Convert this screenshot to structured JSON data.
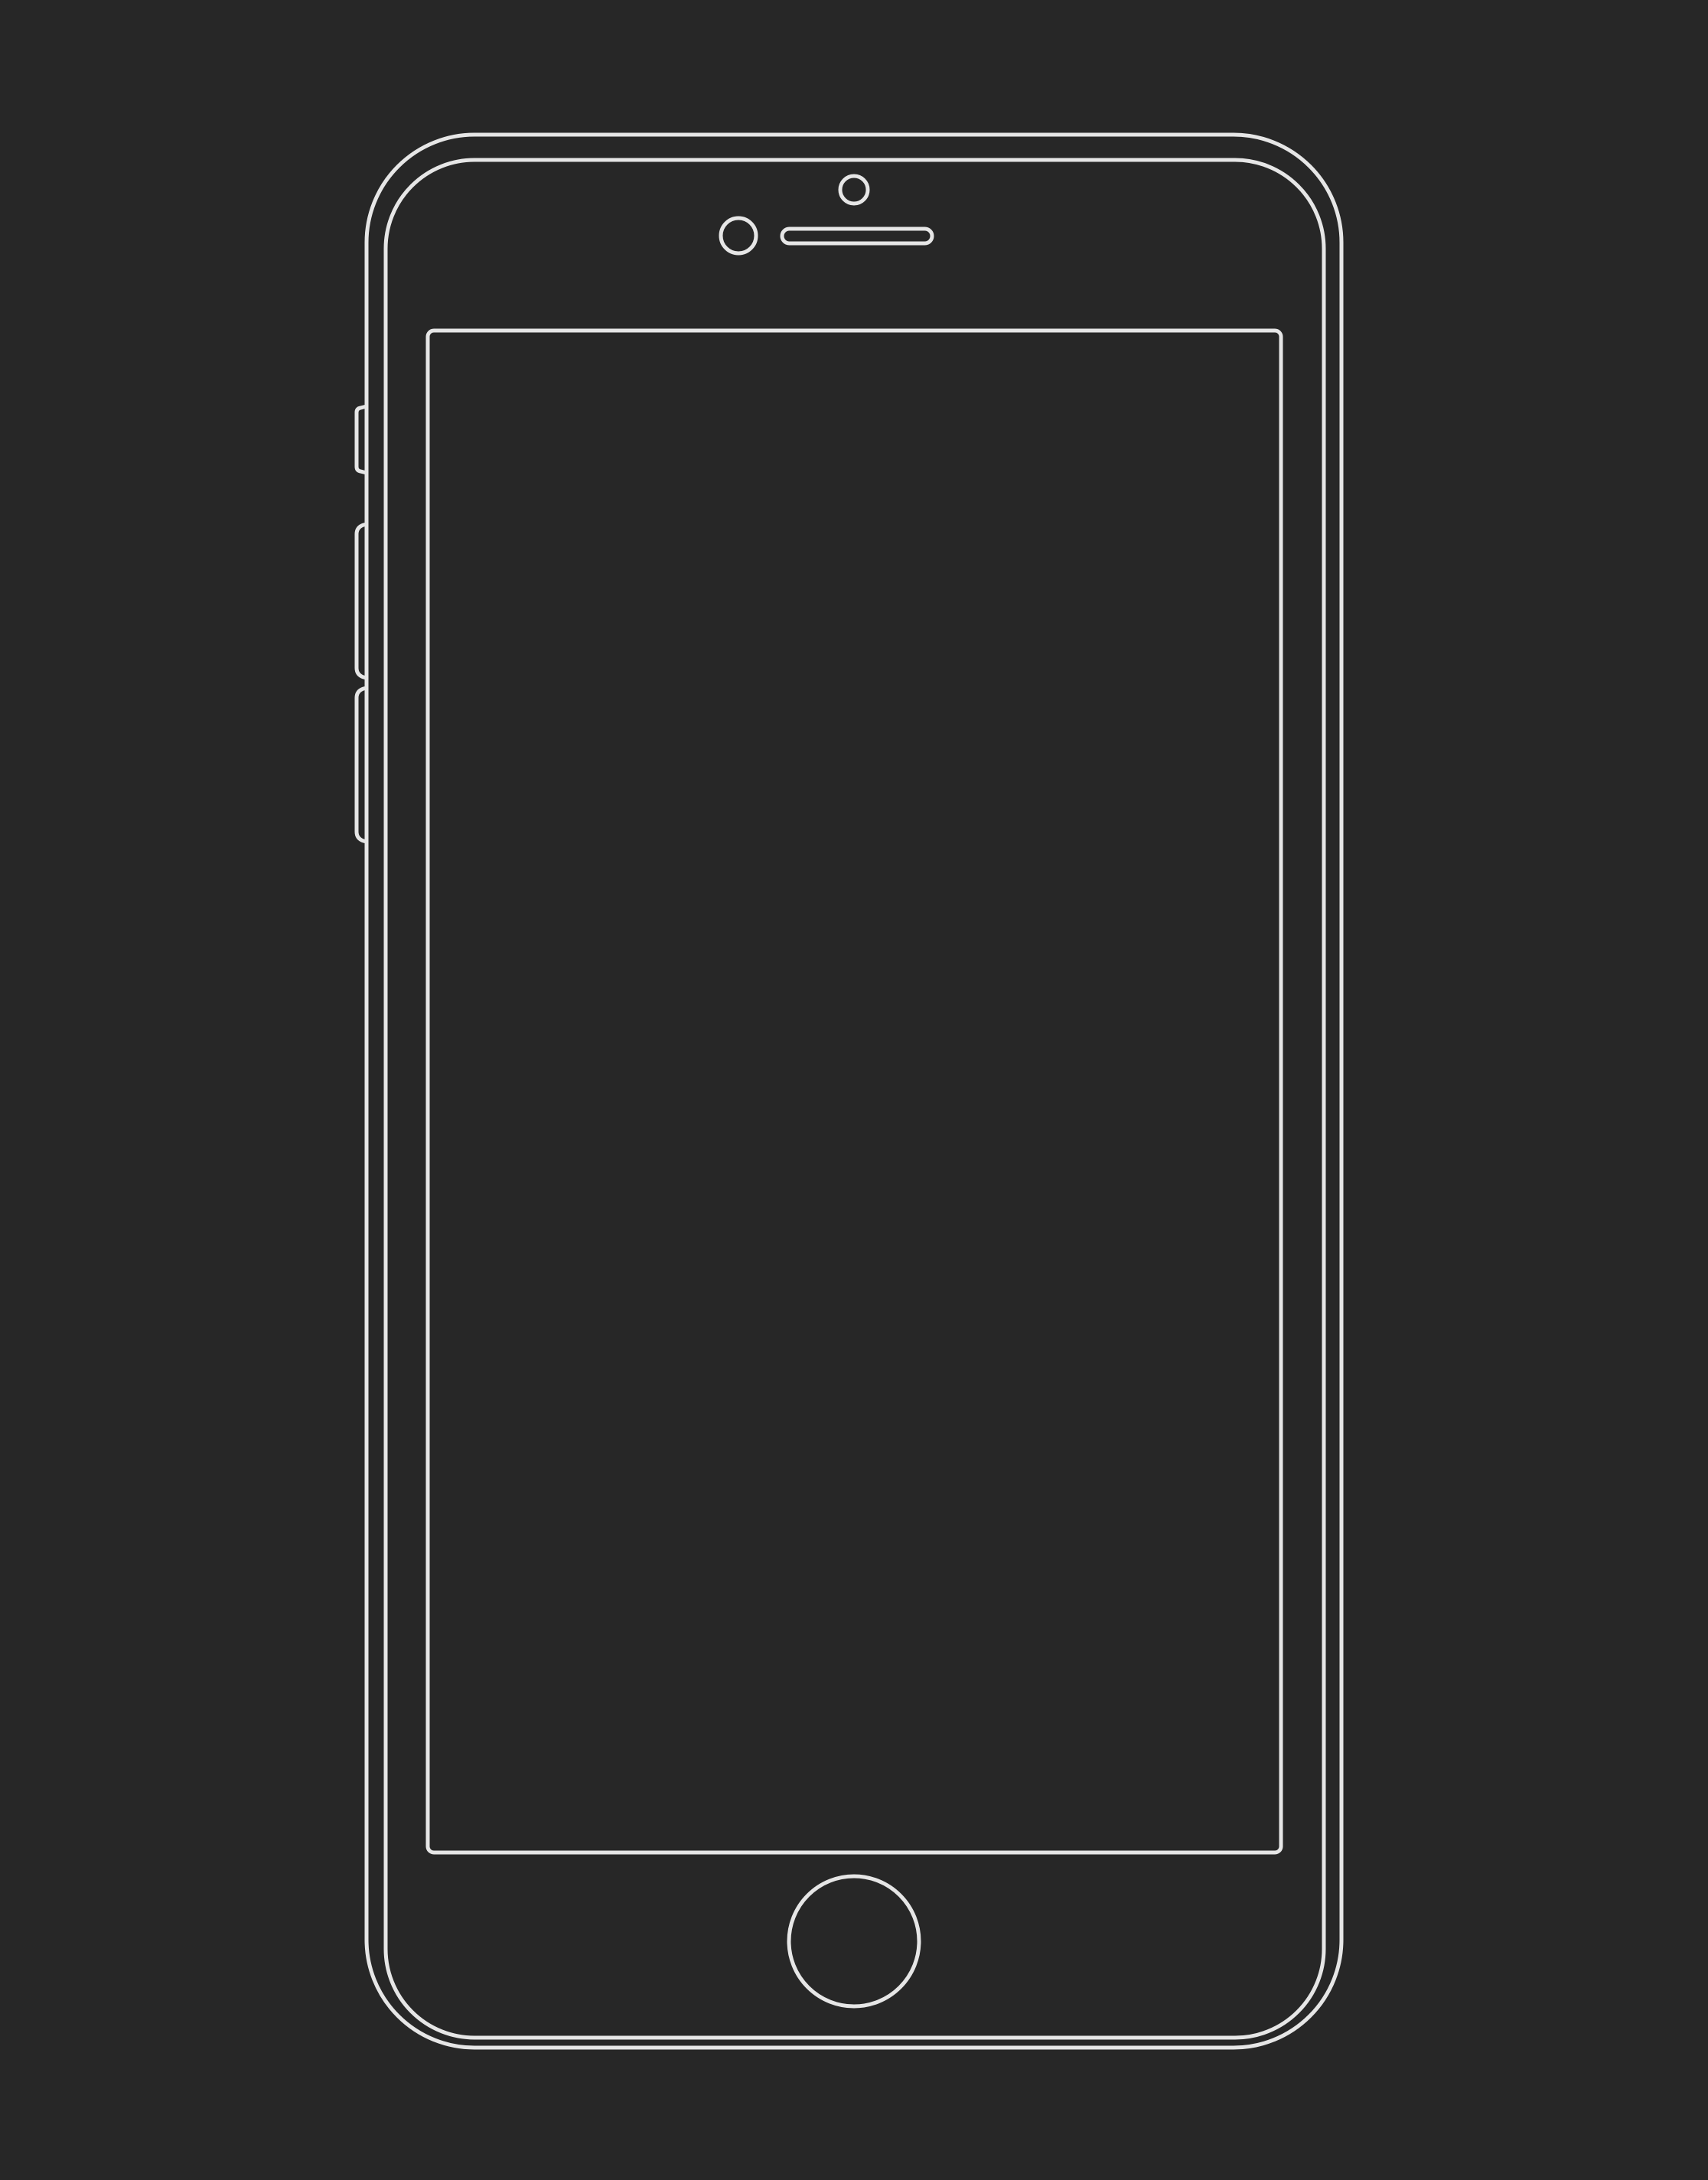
{
  "colors": {
    "background": "#272727",
    "outline": "#e6e6e6"
  },
  "icons": {
    "device": "phone-outline-icon",
    "camera": "front-camera-icon",
    "sensor": "proximity-sensor-icon",
    "speaker": "earpiece-speaker-icon",
    "home": "home-button-icon"
  }
}
